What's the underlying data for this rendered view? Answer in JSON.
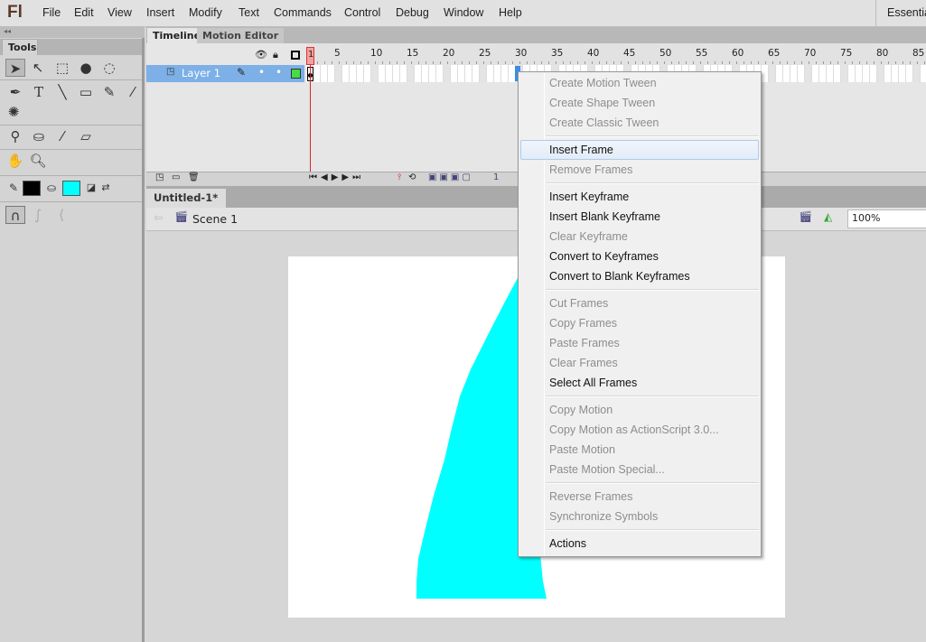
{
  "app": {
    "logo": "Fl",
    "workspace": "Essentials"
  },
  "menu": [
    "File",
    "Edit",
    "View",
    "Insert",
    "Modify",
    "Text",
    "Commands",
    "Control",
    "Debug",
    "Window",
    "Help"
  ],
  "tools": {
    "panel_label": "Tools",
    "collapse": "◂◂",
    "stroke_color": "#000000",
    "fill_color": "#00ffff"
  },
  "timeline": {
    "tabs": [
      "Timeline",
      "Motion Editor"
    ],
    "layer": "Layer 1",
    "ruler": [
      "1",
      "5",
      "10",
      "15",
      "20",
      "25",
      "30",
      "35",
      "40",
      "45",
      "50",
      "55",
      "60",
      "65",
      "70",
      "75",
      "80",
      "85"
    ],
    "current_frame": "1",
    "frame_counter": "1",
    "layer_color": "#44dd44"
  },
  "document": {
    "tab": "Untitled-1*",
    "close": "×",
    "scene": "Scene 1",
    "zoom": "100%"
  },
  "shape_color": "#00ffff",
  "context_menu": [
    [
      {
        "label": "Create Motion Tween",
        "enabled": false
      },
      {
        "label": "Create Shape Tween",
        "enabled": false
      },
      {
        "label": "Create Classic Tween",
        "enabled": false
      }
    ],
    [
      {
        "label": "Insert Frame",
        "enabled": true,
        "highlighted": true
      },
      {
        "label": "Remove Frames",
        "enabled": false
      }
    ],
    [
      {
        "label": "Insert Keyframe",
        "enabled": true
      },
      {
        "label": "Insert Blank Keyframe",
        "enabled": true
      },
      {
        "label": "Clear Keyframe",
        "enabled": false
      },
      {
        "label": "Convert to Keyframes",
        "enabled": true
      },
      {
        "label": "Convert to Blank Keyframes",
        "enabled": true
      }
    ],
    [
      {
        "label": "Cut Frames",
        "enabled": false
      },
      {
        "label": "Copy Frames",
        "enabled": false
      },
      {
        "label": "Paste Frames",
        "enabled": false
      },
      {
        "label": "Clear Frames",
        "enabled": false
      },
      {
        "label": "Select All Frames",
        "enabled": true
      }
    ],
    [
      {
        "label": "Copy Motion",
        "enabled": false
      },
      {
        "label": "Copy Motion as ActionScript 3.0...",
        "enabled": false
      },
      {
        "label": "Paste Motion",
        "enabled": false
      },
      {
        "label": "Paste Motion Special...",
        "enabled": false
      }
    ],
    [
      {
        "label": "Reverse Frames",
        "enabled": false
      },
      {
        "label": "Synchronize Symbols",
        "enabled": false
      }
    ],
    [
      {
        "label": "Actions",
        "enabled": true
      }
    ]
  ]
}
